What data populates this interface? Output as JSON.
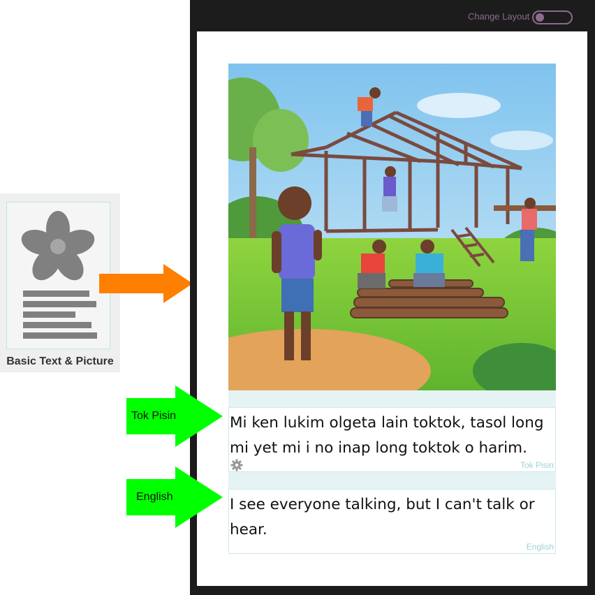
{
  "template": {
    "label": "Basic Text & Picture",
    "icon": "flower-picture-icon"
  },
  "toolbar": {
    "layout_label": "Change Layout",
    "toggle_state": "off"
  },
  "page": {
    "picture_icon": "illustration-house-building-scene",
    "blocks": [
      {
        "language": "Tok Pisin",
        "text": "Mi ken lukim olgeta lain toktok, tasol long mi yet mi i no inap long toktok o harim."
      },
      {
        "language": "English",
        "text": "I see everyone talking, but I can't talk or hear."
      }
    ]
  },
  "callouts": [
    {
      "label": "Tok Pisin"
    },
    {
      "label": "English"
    }
  ],
  "colors": {
    "frame": "#1c1c1c",
    "accent": "#8b6b8e",
    "orange_arrow": "#ff7f00",
    "green_arrow": "#00ff00",
    "lang_label": "#9fd0d4",
    "strip": "#e6f3f4"
  }
}
